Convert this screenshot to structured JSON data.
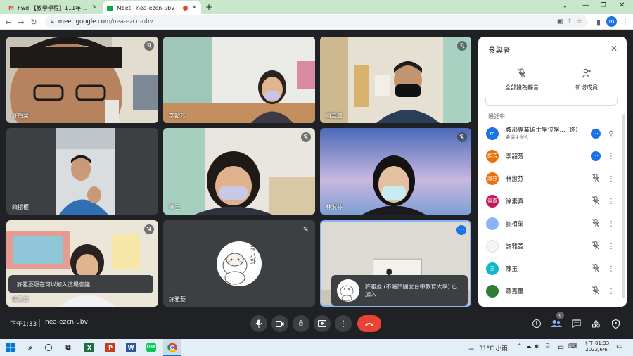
{
  "tabs": [
    {
      "label": "Fwd:【教學學程】111年6月6日...",
      "icon": "gmail-icon"
    },
    {
      "label": "Meet - nea-ezcn-ubv",
      "icon": "meet-icon"
    }
  ],
  "new_tab_label": "+",
  "address": {
    "host": "meet.google.com",
    "path": "/nea-ezcn-ubv"
  },
  "profile_initial": "m",
  "tiles": [
    {
      "name": "許栢榮"
    },
    {
      "name": "李韶芳"
    },
    {
      "name": "蕭嘉璽"
    },
    {
      "name": "賴振權"
    },
    {
      "name": "陳玉"
    },
    {
      "name": "林淑芬"
    },
    {
      "name": "徐素真"
    },
    {
      "name": "許雅菱"
    },
    {
      "name": ""
    }
  ],
  "sticker_text": "有八卦",
  "toast_join_ready": "許雅菱現在可以加入這場會議",
  "toast_joined": "許雅菱 (不屬於國立台中教育大學) 已加入",
  "panel": {
    "title": "參與者",
    "mute_all": "全部設為靜音",
    "add_member": "新增成員",
    "section": "通話中",
    "participants": [
      {
        "name": "教部專業碩士學位學... (你)",
        "sub": "會議主辦人",
        "avatar": "m",
        "color": "#1a73e8"
      },
      {
        "name": "李韶芳",
        "avatar": "韶芳",
        "color": "#e8710a"
      },
      {
        "name": "林淑芬",
        "avatar": "淑芬",
        "color": "#e8710a"
      },
      {
        "name": "徐素真",
        "avatar": "素真",
        "color": "#c2185b"
      },
      {
        "name": "許栢榮",
        "avatar": "",
        "color": "#8ab4f8"
      },
      {
        "name": "許雅菱",
        "avatar": "",
        "color": "#f5f5f5"
      },
      {
        "name": "陳玉",
        "avatar": "玉",
        "color": "#12b5cb"
      },
      {
        "name": "蕭嘉璽",
        "avatar": "",
        "color": "#2e7d32"
      }
    ]
  },
  "meeting": {
    "time": "下午1:33",
    "code": "nea-ezcn-ubv",
    "people_badge": "9"
  },
  "taskbar": {
    "weather": "31°C 小雨",
    "ime": "中",
    "clock_time": "下午 01:33",
    "clock_date": "2022/6/6"
  },
  "colors": {
    "accent": "#1a73e8",
    "end_call": "#ea4335",
    "tab_strip": "#c8e6c9"
  }
}
